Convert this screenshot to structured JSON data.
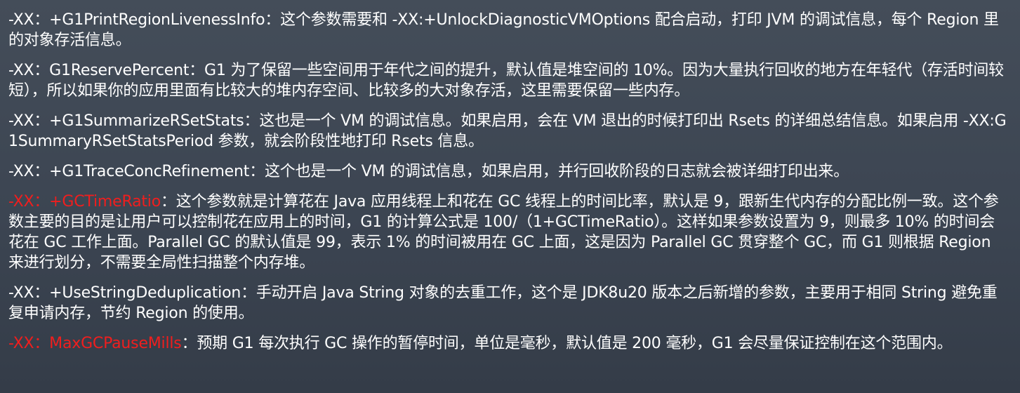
{
  "colors": {
    "background": "#3f4854",
    "text": "#ffffff",
    "highlight": "#f01e1e"
  },
  "items": [
    {
      "param": "-XX：+G1PrintRegionLivenessInfo",
      "desc": "：这个参数需要和 -XX:+UnlockDiagnosticVMOptions 配合启动，打印 JVM 的调试信息，每个 Region 里的对象存活信息。",
      "highlight": false
    },
    {
      "param": "-XX：G1ReservePercent",
      "desc": "：G1 为了保留一些空间用于年代之间的提升，默认值是堆空间的 10%。因为大量执行回收的地方在年轻代（存活时间较短），所以如果你的应用里面有比较大的堆内存空间、比较多的大对象存活，这里需要保留一些内存。",
      "highlight": false
    },
    {
      "param": "-XX：+G1SummarizeRSetStats",
      "desc": "：这也是一个 VM 的调试信息。如果启用，会在 VM 退出的时候打印出 Rsets 的详细总结信息。如果启用 -XX:G1SummaryRSetStatsPeriod 参数，就会阶段性地打印 Rsets 信息。",
      "highlight": false
    },
    {
      "param": "-XX：+G1TraceConcRefinement",
      "desc": "：这个也是一个 VM 的调试信息，如果启用，并行回收阶段的日志就会被详细打印出来。",
      "highlight": false
    },
    {
      "param": "-XX：+GCTimeRatio",
      "desc": "：这个参数就是计算花在 Java 应用线程上和花在 GC 线程上的时间比率，默认是 9，跟新生代内存的分配比例一致。这个参数主要的目的是让用户可以控制花在应用上的时间，G1 的计算公式是 100/（1+GCTimeRatio）。这样如果参数设置为 9，则最多 10% 的时间会花在 GC 工作上面。Parallel GC 的默认值是 99，表示 1% 的时间被用在 GC 上面，这是因为 Parallel GC 贯穿整个 GC，而 G1 则根据 Region 来进行划分，不需要全局性扫描整个内存堆。",
      "highlight": true
    },
    {
      "param": "-XX：+UseStringDeduplication",
      "desc": "：手动开启 Java String 对象的去重工作，这个是  JDK8u20 版本之后新增的参数，主要用于相同 String 避免重复申请内存，节约 Region 的使用。",
      "highlight": false
    },
    {
      "param": "-XX：MaxGCPauseMills",
      "desc": "：预期 G1 每次执行 GC 操作的暂停时间，单位是毫秒，默认值是 200 毫秒，G1 会尽量保证控制在这个范围内。",
      "highlight": true
    }
  ]
}
